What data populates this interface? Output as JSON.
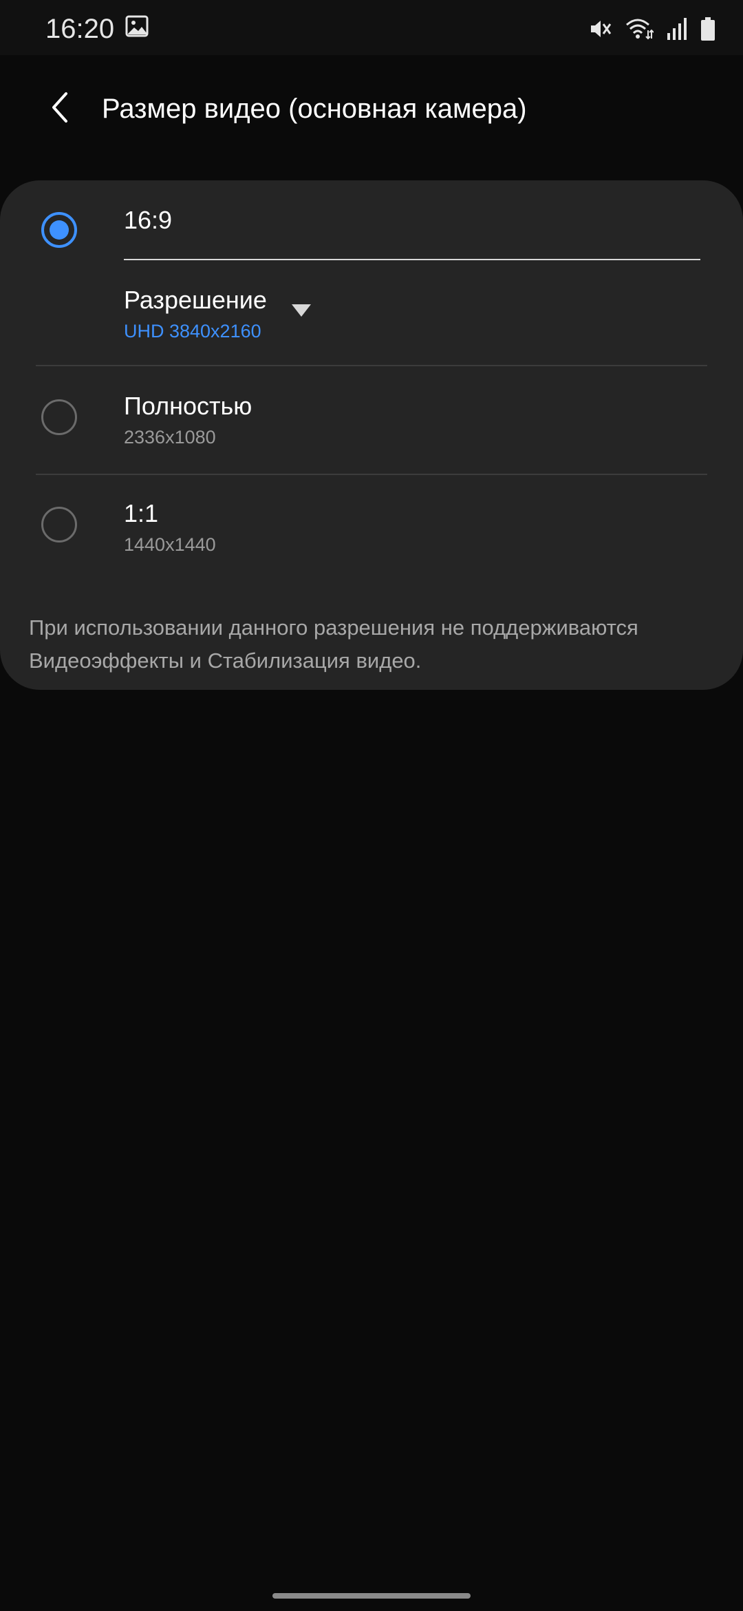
{
  "status_bar": {
    "time": "16:20",
    "icons": [
      "gallery-icon",
      "mute-icon",
      "wifi-icon",
      "signal-icon",
      "battery-icon"
    ]
  },
  "header": {
    "title": "Размер видео (основная камера)",
    "back_icon": "back-arrow-icon"
  },
  "options": [
    {
      "title": "16:9",
      "selected": true,
      "resolution_label": "Разрешение",
      "resolution_value": "UHD 3840x2160"
    },
    {
      "title": "Полностью",
      "subtitle": "2336x1080",
      "selected": false
    },
    {
      "title": "1:1",
      "subtitle": "1440x1440",
      "selected": false
    }
  ],
  "note": "При использовании данного разрешения не поддерживаются Видеоэффекты и Стабилизация видео.",
  "colors": {
    "accent": "#3e91ff",
    "background": "#0a0a0a",
    "card": "#252525"
  }
}
